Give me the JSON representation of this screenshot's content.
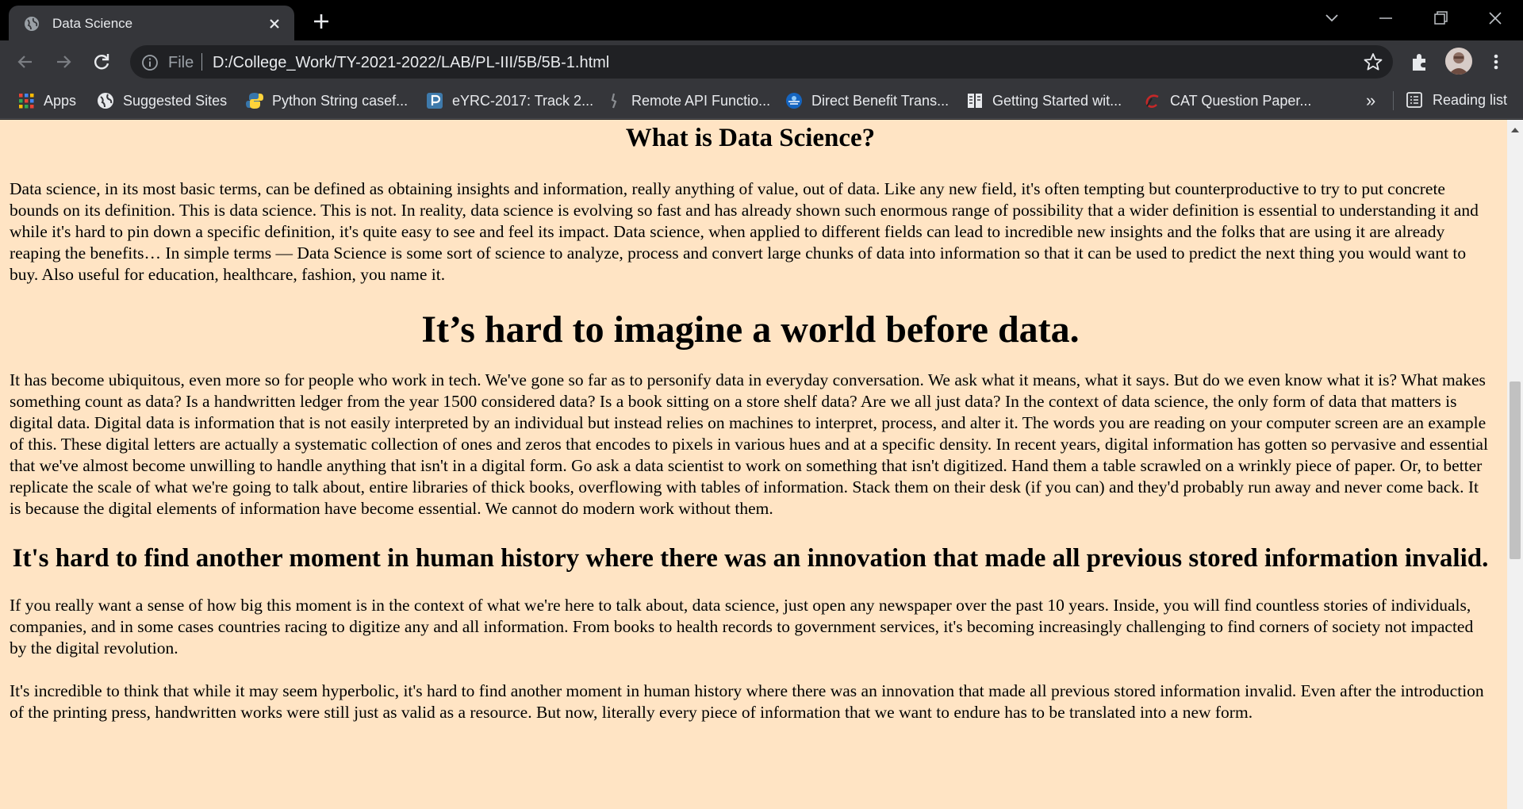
{
  "browser": {
    "tab": {
      "title": "Data Science"
    },
    "address": {
      "scheme": "File",
      "url": "D:/College_Work/TY-2021-2022/LAB/PL-III/5B/5B-1.html"
    },
    "bookmarks": [
      {
        "label": "Apps",
        "icon": "apps-grid-icon"
      },
      {
        "label": "Suggested Sites",
        "icon": "globe-icon"
      },
      {
        "label": "Python String casef...",
        "icon": "python-icon"
      },
      {
        "label": "eYRC-2017: Track 2...",
        "icon": "piazza-icon"
      },
      {
        "label": "Remote API Functio...",
        "icon": "coppelia-icon"
      },
      {
        "label": "Direct Benefit Trans...",
        "icon": "dbt-icon"
      },
      {
        "label": "Getting Started wit...",
        "icon": "docs-icon"
      },
      {
        "label": "CAT Question Paper...",
        "icon": "cat-icon"
      }
    ],
    "bookmarks_more": "»",
    "reading_list": "Reading list"
  },
  "page": {
    "heading1": "What is Data Science?",
    "para1": "Data science, in its most basic terms, can be defined as obtaining insights and information, really anything of value, out of data. Like any new field, it's often tempting but counterproductive to try to put concrete bounds on its definition. This is data science. This is not. In reality, data science is evolving so fast and has already shown such enormous range of possibility that a wider definition is essential to understanding it and while it's hard to pin down a specific definition, it's quite easy to see and feel its impact. Data science, when applied to different fields can lead to incredible new insights and the folks that are using it are already reaping the benefits… In simple terms — Data Science is some sort of science to analyze, process and convert large chunks of data into information so that it can be used to predict the next thing you would want to buy. Also useful for education, healthcare, fashion, you name it.",
    "heading2": "It’s hard to imagine a world before data.",
    "para2": "It has become ubiquitous, even more so for people who work in tech. We've gone so far as to personify data in everyday conversation. We ask what it means, what it says. But do we even know what it is? What makes something count as data? Is a handwritten ledger from the year 1500 considered data? Is a book sitting on a store shelf data? Are we all just data? In the context of data science, the only form of data that matters is digital data. Digital data is information that is not easily interpreted by an individual but instead relies on machines to interpret, process, and alter it. The words you are reading on your computer screen are an example of this. These digital letters are actually a systematic collection of ones and zeros that encodes to pixels in various hues and at a specific density. In recent years, digital information has gotten so pervasive and essential that we've almost become unwilling to handle anything that isn't in a digital form. Go ask a data scientist to work on something that isn't digitized. Hand them a table scrawled on a wrinkly piece of paper. Or, to better replicate the scale of what we're going to talk about, entire libraries of thick books, overflowing with tables of information. Stack them on their desk (if you can) and they'd probably run away and never come back. It is because the digital elements of information have become essential. We cannot do modern work without them.",
    "heading3": "It's hard to find another moment in human history where there was an innovation that made all previous stored information invalid.",
    "para3": "If you really want a sense of how big this moment is in the context of what we're here to talk about, data science, just open any newspaper over the past 10 years. Inside, you will find countless stories of individuals, companies, and in some cases countries racing to digitize any and all information. From books to health records to government services, it's becoming increasingly challenging to find corners of society not impacted by the digital revolution.",
    "para4": "It's incredible to think that while it may seem hyperbolic, it's hard to find another moment in human history where there was an innovation that made all previous stored information invalid. Even after the introduction of the printing press, handwritten works were still just as valid as a resource. But now, literally every piece of information that we want to endure has to be translated into a new form."
  },
  "colors": {
    "page_background": "#ffe4c4",
    "toolbar": "#35363a",
    "tabstrip": "#000000"
  }
}
